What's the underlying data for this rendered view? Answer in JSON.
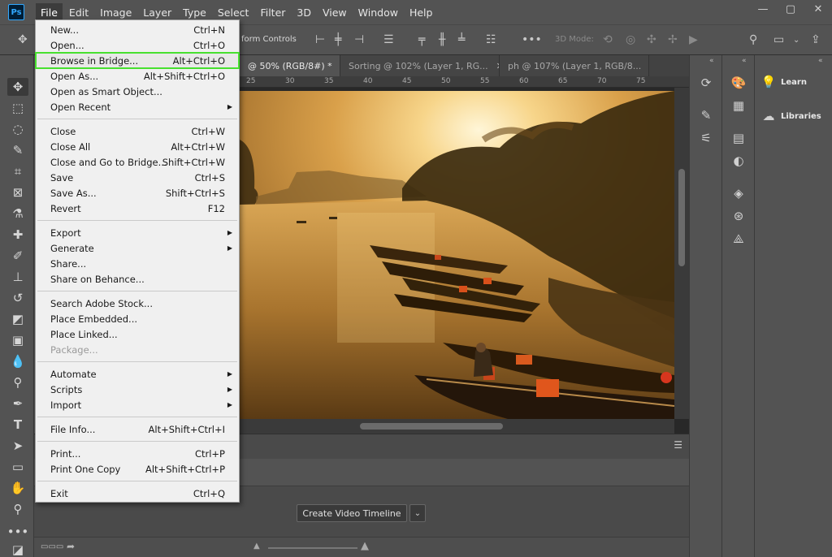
{
  "app": {
    "logo": "Ps"
  },
  "menubar": [
    "File",
    "Edit",
    "Image",
    "Layer",
    "Type",
    "Select",
    "Filter",
    "3D",
    "View",
    "Window",
    "Help"
  ],
  "window_controls": [
    "—",
    "▢",
    "✕"
  ],
  "options_bar": {
    "transform_label": "form Controls",
    "mode3d_label": "3D Mode:"
  },
  "tabs": [
    {
      "label": "@ 50% (RGB/8#) *",
      "close": "✕"
    },
    {
      "label": "Sorting @ 102% (Layer 1, RG...",
      "close": "✕"
    },
    {
      "label": "ph @ 107% (Layer 1, RGB/8...",
      "close": "✕"
    }
  ],
  "ruler_ticks": [
    "25",
    "30",
    "35",
    "40",
    "45",
    "50",
    "55",
    "60",
    "65",
    "70",
    "75"
  ],
  "timeline": {
    "create_button": "Create Video Timeline",
    "dropdown": "⌄"
  },
  "panels": {
    "learn": "Learn",
    "libraries": "Libraries"
  },
  "file_menu": {
    "groups": [
      [
        {
          "label": "New...",
          "shortcut": "Ctrl+N"
        },
        {
          "label": "Open...",
          "shortcut": "Ctrl+O"
        },
        {
          "label": "Browse in Bridge...",
          "shortcut": "Alt+Ctrl+O",
          "highlighted": true
        },
        {
          "label": "Open As...",
          "shortcut": "Alt+Shift+Ctrl+O"
        },
        {
          "label": "Open as Smart Object...",
          "shortcut": ""
        },
        {
          "label": "Open Recent",
          "shortcut": "",
          "submenu": true
        }
      ],
      [
        {
          "label": "Close",
          "shortcut": "Ctrl+W"
        },
        {
          "label": "Close All",
          "shortcut": "Alt+Ctrl+W"
        },
        {
          "label": "Close and Go to Bridge...",
          "shortcut": "Shift+Ctrl+W"
        },
        {
          "label": "Save",
          "shortcut": "Ctrl+S"
        },
        {
          "label": "Save As...",
          "shortcut": "Shift+Ctrl+S"
        },
        {
          "label": "Revert",
          "shortcut": "F12"
        }
      ],
      [
        {
          "label": "Export",
          "shortcut": "",
          "submenu": true
        },
        {
          "label": "Generate",
          "shortcut": "",
          "submenu": true
        },
        {
          "label": "Share...",
          "shortcut": ""
        },
        {
          "label": "Share on Behance...",
          "shortcut": ""
        }
      ],
      [
        {
          "label": "Search Adobe Stock...",
          "shortcut": ""
        },
        {
          "label": "Place Embedded...",
          "shortcut": ""
        },
        {
          "label": "Place Linked...",
          "shortcut": ""
        },
        {
          "label": "Package...",
          "shortcut": "",
          "disabled": true
        }
      ],
      [
        {
          "label": "Automate",
          "shortcut": "",
          "submenu": true
        },
        {
          "label": "Scripts",
          "shortcut": "",
          "submenu": true
        },
        {
          "label": "Import",
          "shortcut": "",
          "submenu": true
        }
      ],
      [
        {
          "label": "File Info...",
          "shortcut": "Alt+Shift+Ctrl+I"
        }
      ],
      [
        {
          "label": "Print...",
          "shortcut": "Ctrl+P"
        },
        {
          "label": "Print One Copy",
          "shortcut": "Alt+Shift+Ctrl+P"
        }
      ],
      [
        {
          "label": "Exit",
          "shortcut": "Ctrl+Q"
        }
      ]
    ]
  },
  "colors": {
    "highlight_outline": "#47e02f",
    "menu_bg": "#f0f0f0",
    "ui_bg": "#535353",
    "accent": "#31a8ff"
  }
}
